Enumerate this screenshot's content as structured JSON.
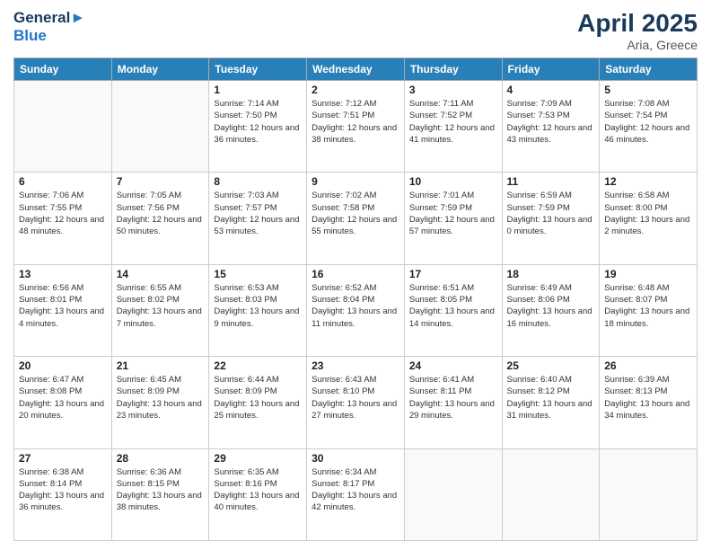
{
  "header": {
    "logo_line1": "General",
    "logo_line2": "Blue",
    "month": "April 2025",
    "location": "Aria, Greece"
  },
  "weekdays": [
    "Sunday",
    "Monday",
    "Tuesday",
    "Wednesday",
    "Thursday",
    "Friday",
    "Saturday"
  ],
  "weeks": [
    [
      {
        "day": "",
        "info": ""
      },
      {
        "day": "",
        "info": ""
      },
      {
        "day": "1",
        "info": "Sunrise: 7:14 AM\nSunset: 7:50 PM\nDaylight: 12 hours and 36 minutes."
      },
      {
        "day": "2",
        "info": "Sunrise: 7:12 AM\nSunset: 7:51 PM\nDaylight: 12 hours and 38 minutes."
      },
      {
        "day": "3",
        "info": "Sunrise: 7:11 AM\nSunset: 7:52 PM\nDaylight: 12 hours and 41 minutes."
      },
      {
        "day": "4",
        "info": "Sunrise: 7:09 AM\nSunset: 7:53 PM\nDaylight: 12 hours and 43 minutes."
      },
      {
        "day": "5",
        "info": "Sunrise: 7:08 AM\nSunset: 7:54 PM\nDaylight: 12 hours and 46 minutes."
      }
    ],
    [
      {
        "day": "6",
        "info": "Sunrise: 7:06 AM\nSunset: 7:55 PM\nDaylight: 12 hours and 48 minutes."
      },
      {
        "day": "7",
        "info": "Sunrise: 7:05 AM\nSunset: 7:56 PM\nDaylight: 12 hours and 50 minutes."
      },
      {
        "day": "8",
        "info": "Sunrise: 7:03 AM\nSunset: 7:57 PM\nDaylight: 12 hours and 53 minutes."
      },
      {
        "day": "9",
        "info": "Sunrise: 7:02 AM\nSunset: 7:58 PM\nDaylight: 12 hours and 55 minutes."
      },
      {
        "day": "10",
        "info": "Sunrise: 7:01 AM\nSunset: 7:59 PM\nDaylight: 12 hours and 57 minutes."
      },
      {
        "day": "11",
        "info": "Sunrise: 6:59 AM\nSunset: 7:59 PM\nDaylight: 13 hours and 0 minutes."
      },
      {
        "day": "12",
        "info": "Sunrise: 6:58 AM\nSunset: 8:00 PM\nDaylight: 13 hours and 2 minutes."
      }
    ],
    [
      {
        "day": "13",
        "info": "Sunrise: 6:56 AM\nSunset: 8:01 PM\nDaylight: 13 hours and 4 minutes."
      },
      {
        "day": "14",
        "info": "Sunrise: 6:55 AM\nSunset: 8:02 PM\nDaylight: 13 hours and 7 minutes."
      },
      {
        "day": "15",
        "info": "Sunrise: 6:53 AM\nSunset: 8:03 PM\nDaylight: 13 hours and 9 minutes."
      },
      {
        "day": "16",
        "info": "Sunrise: 6:52 AM\nSunset: 8:04 PM\nDaylight: 13 hours and 11 minutes."
      },
      {
        "day": "17",
        "info": "Sunrise: 6:51 AM\nSunset: 8:05 PM\nDaylight: 13 hours and 14 minutes."
      },
      {
        "day": "18",
        "info": "Sunrise: 6:49 AM\nSunset: 8:06 PM\nDaylight: 13 hours and 16 minutes."
      },
      {
        "day": "19",
        "info": "Sunrise: 6:48 AM\nSunset: 8:07 PM\nDaylight: 13 hours and 18 minutes."
      }
    ],
    [
      {
        "day": "20",
        "info": "Sunrise: 6:47 AM\nSunset: 8:08 PM\nDaylight: 13 hours and 20 minutes."
      },
      {
        "day": "21",
        "info": "Sunrise: 6:45 AM\nSunset: 8:09 PM\nDaylight: 13 hours and 23 minutes."
      },
      {
        "day": "22",
        "info": "Sunrise: 6:44 AM\nSunset: 8:09 PM\nDaylight: 13 hours and 25 minutes."
      },
      {
        "day": "23",
        "info": "Sunrise: 6:43 AM\nSunset: 8:10 PM\nDaylight: 13 hours and 27 minutes."
      },
      {
        "day": "24",
        "info": "Sunrise: 6:41 AM\nSunset: 8:11 PM\nDaylight: 13 hours and 29 minutes."
      },
      {
        "day": "25",
        "info": "Sunrise: 6:40 AM\nSunset: 8:12 PM\nDaylight: 13 hours and 31 minutes."
      },
      {
        "day": "26",
        "info": "Sunrise: 6:39 AM\nSunset: 8:13 PM\nDaylight: 13 hours and 34 minutes."
      }
    ],
    [
      {
        "day": "27",
        "info": "Sunrise: 6:38 AM\nSunset: 8:14 PM\nDaylight: 13 hours and 36 minutes."
      },
      {
        "day": "28",
        "info": "Sunrise: 6:36 AM\nSunset: 8:15 PM\nDaylight: 13 hours and 38 minutes."
      },
      {
        "day": "29",
        "info": "Sunrise: 6:35 AM\nSunset: 8:16 PM\nDaylight: 13 hours and 40 minutes."
      },
      {
        "day": "30",
        "info": "Sunrise: 6:34 AM\nSunset: 8:17 PM\nDaylight: 13 hours and 42 minutes."
      },
      {
        "day": "",
        "info": ""
      },
      {
        "day": "",
        "info": ""
      },
      {
        "day": "",
        "info": ""
      }
    ]
  ]
}
